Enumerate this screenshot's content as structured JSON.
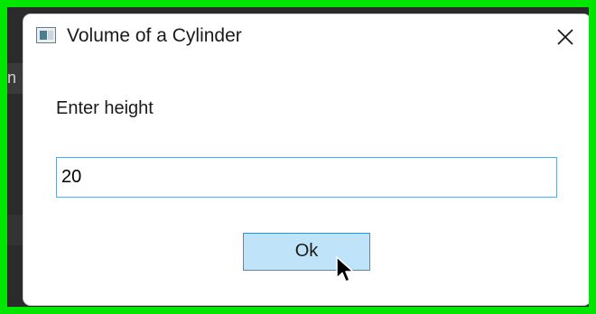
{
  "window": {
    "title": "Volume of a Cylinder",
    "close_label": "✕"
  },
  "background": {
    "partial_letter": "n"
  },
  "form": {
    "prompt": "Enter height",
    "input_value": "20",
    "ok_label": "Ok"
  },
  "colors": {
    "outer_border": "#00e600",
    "button_fill": "#bfe3f8",
    "button_border": "#3c8fd0",
    "input_border": "#6aa3d4"
  },
  "icons": {
    "app": "window-app-icon",
    "close": "close-icon",
    "cursor": "mouse-pointer-icon"
  }
}
